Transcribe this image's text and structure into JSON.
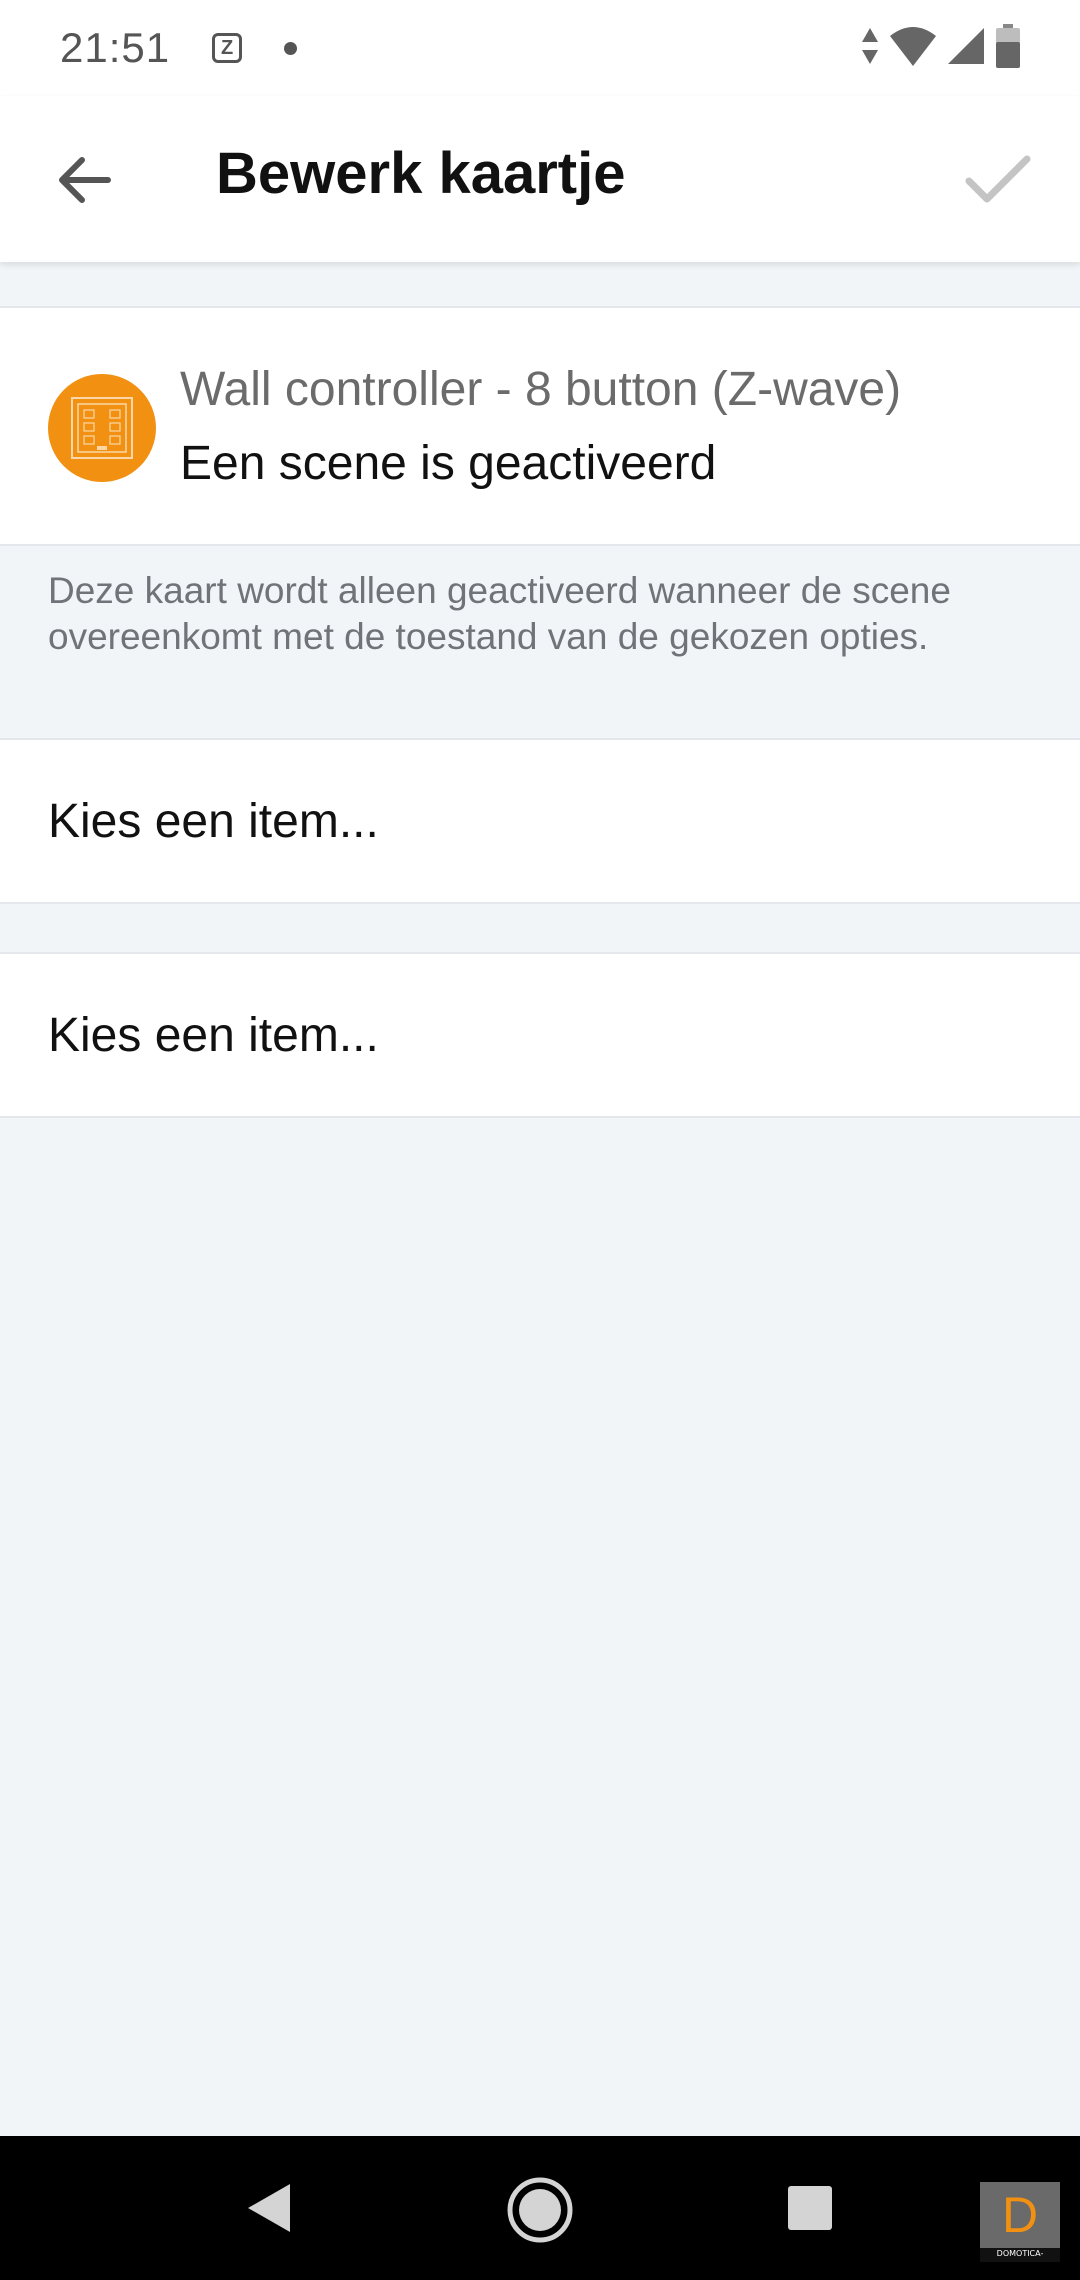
{
  "status_bar": {
    "time": "21:51",
    "notification_icons": [
      "zwave-app-icon",
      "dot-icon"
    ],
    "system_icons": [
      "data-arrows-icon",
      "wifi-icon",
      "cell-signal-icon",
      "battery-icon"
    ],
    "app_icon_glyph": "Z"
  },
  "app_bar": {
    "title": "Bewerk kaartje",
    "back_icon": "arrow-left-icon",
    "confirm_icon": "check-icon"
  },
  "card": {
    "device_name": "Wall controller - 8 button (Z-wave)",
    "trigger": "Een scene is geactiveerd",
    "device_icon": "wall-controller-icon",
    "avatar_color": "#f29111"
  },
  "hint": "Deze kaart wordt alleen geactiveerd wanneer de scene overeenkomt met de toestand van de gekozen opties.",
  "selectors": [
    {
      "label": "Kies een item..."
    },
    {
      "label": "Kies een item..."
    }
  ],
  "nav_bar": {
    "buttons": [
      "back-triangle-icon",
      "home-circle-icon",
      "recents-square-icon"
    ]
  },
  "watermark": {
    "letter": "D",
    "text": "DOMOTICA-BLOG.NL"
  },
  "colors": {
    "accent": "#f29111",
    "background": "#f2f5f8",
    "surface": "#ffffff"
  }
}
